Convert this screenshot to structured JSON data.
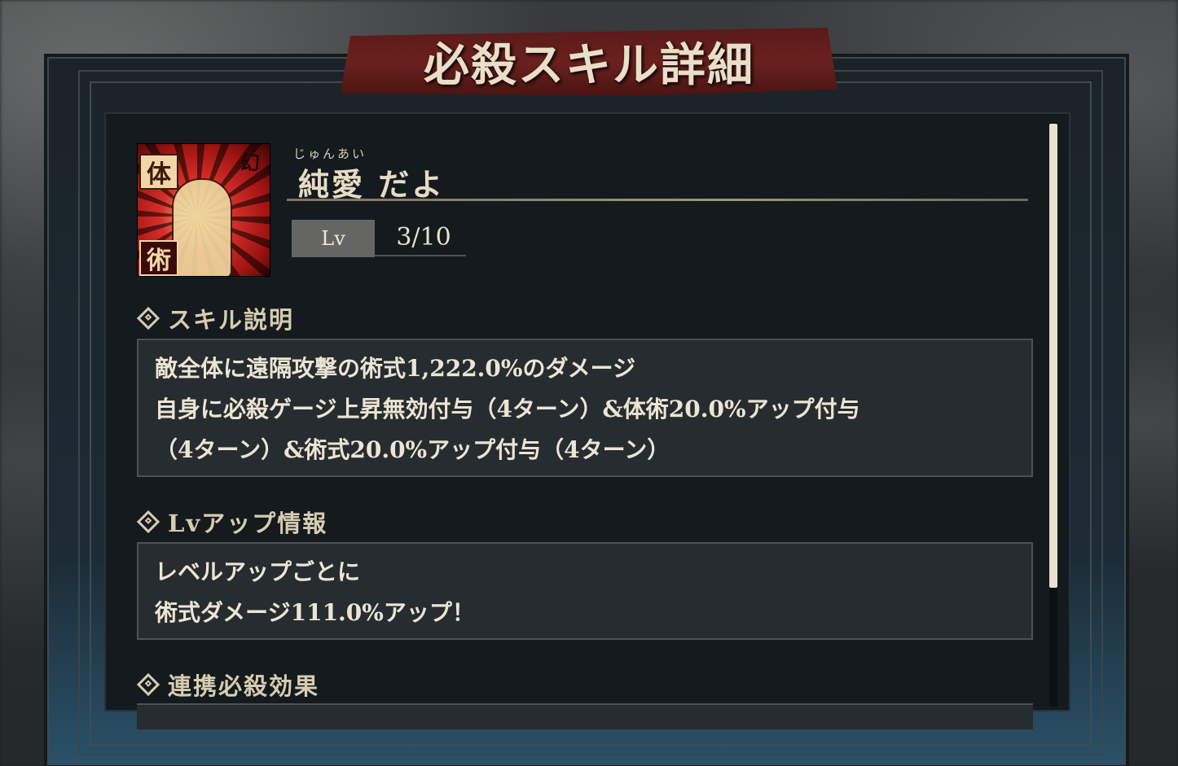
{
  "title": "必殺スキル詳細",
  "skill": {
    "ruby": "じゅんあい",
    "name": "純愛 だよ",
    "icon_tags": {
      "tai": "体",
      "jutsu": "術",
      "gen": "幻"
    },
    "level_label": "Lv",
    "level_value": "3/10"
  },
  "sections": {
    "description": {
      "heading": "スキル説明",
      "lines": [
        "敵全体に遠隔攻撃の術式1,222.0%のダメージ",
        "自身に必殺ゲージ上昇無効付与（4ターン）&体術20.0%アップ付与",
        "（4ターン）&術式20.0%アップ付与（4ターン）"
      ]
    },
    "levelup": {
      "heading": "Lvアップ情報",
      "lines": [
        "レベルアップごとに",
        "術式ダメージ111.0%アップ！"
      ]
    },
    "combo": {
      "heading": "連携必殺効果"
    }
  }
}
